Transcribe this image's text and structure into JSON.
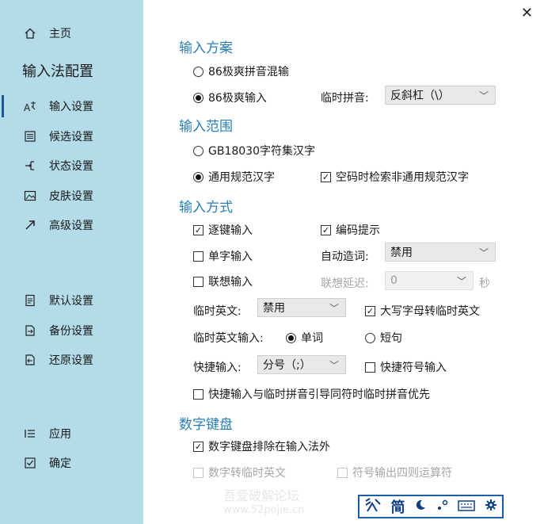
{
  "sidebar": {
    "home": {
      "label": "主页",
      "icon": "home-icon"
    },
    "title": "输入法配置",
    "nav": [
      {
        "label": "输入设置",
        "icon": "input-settings-icon"
      },
      {
        "label": "候选设置",
        "icon": "candidate-settings-icon"
      },
      {
        "label": "状态设置",
        "icon": "status-settings-icon"
      },
      {
        "label": "皮肤设置",
        "icon": "skin-settings-icon"
      },
      {
        "label": "高级设置",
        "icon": "advanced-settings-icon"
      }
    ],
    "actions": [
      {
        "label": "默认设置",
        "icon": "default-settings-icon"
      },
      {
        "label": "备份设置",
        "icon": "backup-settings-icon"
      },
      {
        "label": "还原设置",
        "icon": "restore-settings-icon"
      }
    ],
    "apply": "应用",
    "ok": "确定",
    "selected": "输入设置",
    "bg_color": "#b3dbe8"
  },
  "scheme": {
    "heading": "输入方案",
    "opt_mixed": "86极爽拼音混输",
    "opt_86": "86极爽输入",
    "temp_pinyin_label": "临时拼音:",
    "temp_pinyin_value": "反斜杠（\\）"
  },
  "range": {
    "heading": "输入范围",
    "opt_gb": "GB18030字符集汉字",
    "opt_general": "通用规范汉字",
    "search_nonstandard": "空码时检索非通用规范汉字"
  },
  "method": {
    "heading": "输入方式",
    "stepwise": "逐键输入",
    "code_hint": "编码提示",
    "single_char": "单字输入",
    "auto_word_label": "自动造词:",
    "auto_word_value": "禁用",
    "associative": "联想输入",
    "assoc_delay_label": "联想延迟:",
    "assoc_delay_value": "0",
    "seconds": "秒",
    "temp_english_label": "临时英文:",
    "temp_english_value": "禁用",
    "caps_temp_english": "大写字母转临时英文",
    "temp_english_input_label": "临时英文输入:",
    "opt_word": "单词",
    "opt_phrase": "短句",
    "quick_input_label": "快捷输入:",
    "quick_input_value": "分号（;）",
    "quick_symbol_input": "快捷符号输入",
    "quick_priority": "快捷输入与临时拼音引导同符时临时拼音优先"
  },
  "numpad": {
    "heading": "数字键盘",
    "exclude": "数字键盘排除在输入法外",
    "num_to_english": "数字转临时英文",
    "symbol_arith": "符号输出四则运算符"
  },
  "toolbar": {
    "mode": "简",
    "icons": [
      "logo-icon",
      "moon-icon",
      "punctuation-icon",
      "keyboard-icon",
      "gear-icon"
    ]
  },
  "watermark": {
    "line1": "吾爱破解论坛",
    "line2": "www.52pojie.cn"
  },
  "accent_color": "#2a7fb2"
}
